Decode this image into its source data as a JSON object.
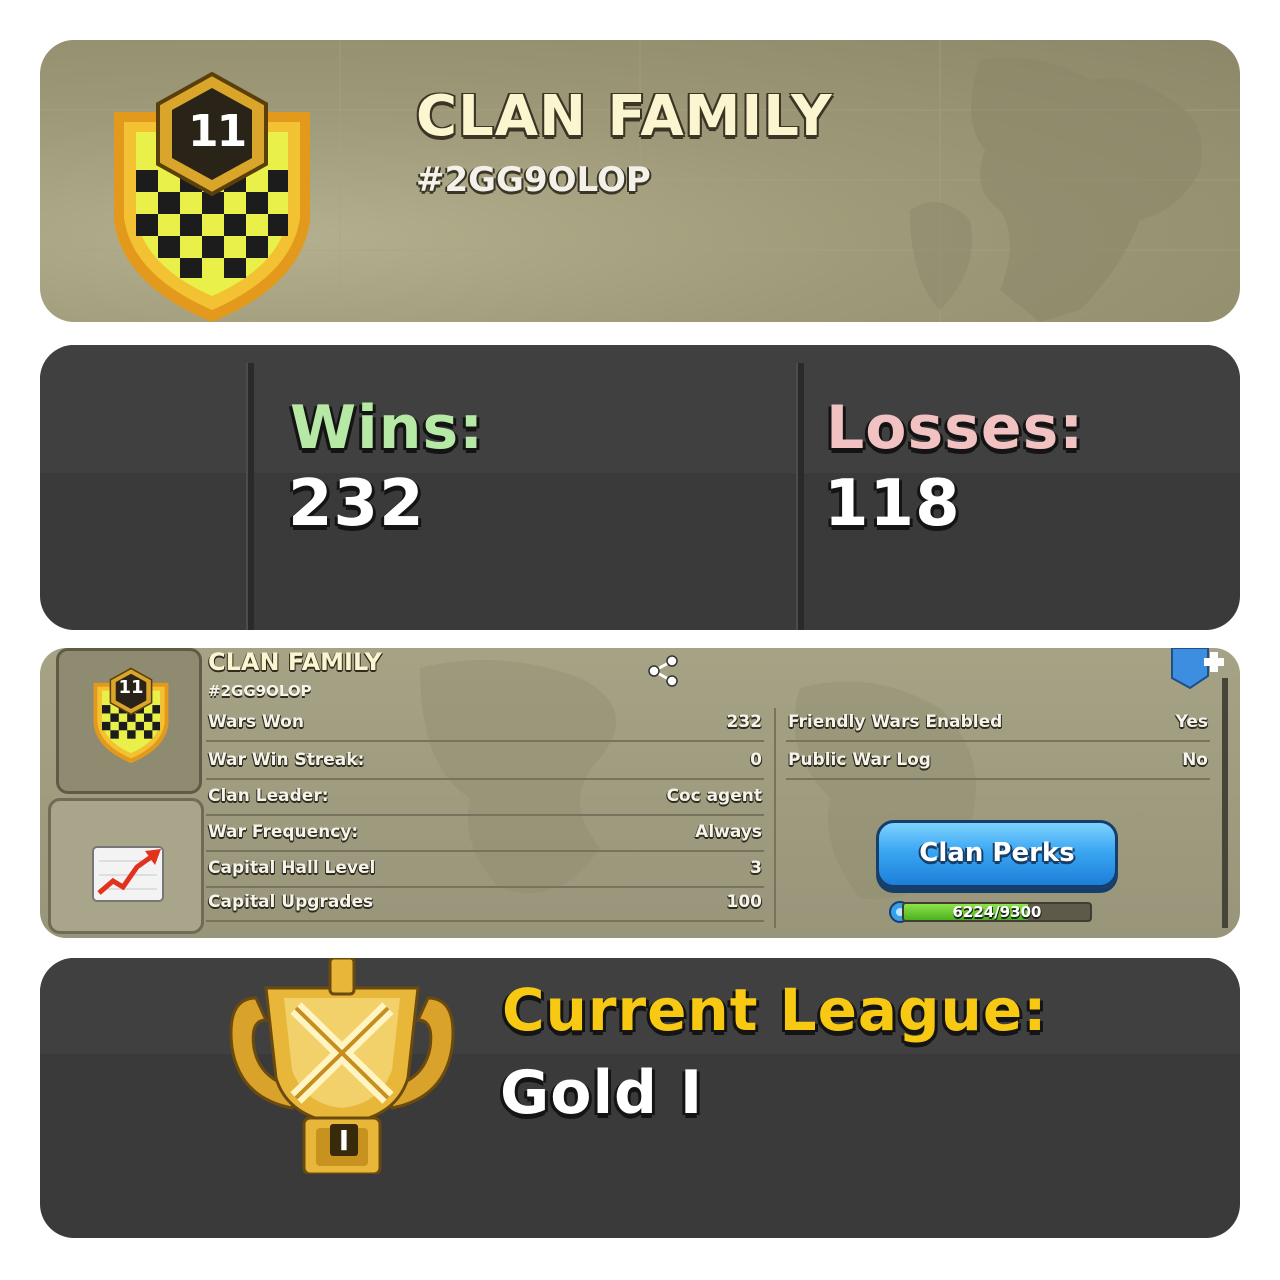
{
  "header": {
    "clan_name": "CLAN FAMILY",
    "clan_tag": "#2GG9OLOP",
    "badge_level": "11"
  },
  "war_stats": {
    "wins_label": "Wins:",
    "wins_value": "232",
    "losses_label": "Losses:",
    "losses_value": "118"
  },
  "clan_info": {
    "clan_name": "CLAN FAMILY",
    "clan_tag": "#2GG9OLOP",
    "badge_level": "11",
    "left_rows": [
      {
        "label": "Wars Won",
        "value": "232"
      },
      {
        "label": "War Win Streak:",
        "value": "0"
      },
      {
        "label": "Clan Leader:",
        "value": "Coc agent"
      },
      {
        "label": "War Frequency:",
        "value": "Always"
      },
      {
        "label": "Capital Hall Level",
        "value": "3"
      },
      {
        "label": "Capital Upgrades",
        "value": "100"
      }
    ],
    "right_rows": [
      {
        "label": "Friendly Wars Enabled",
        "value": "Yes"
      },
      {
        "label": "Public War Log",
        "value": "No"
      }
    ],
    "perks_button": "Clan Perks",
    "xp_text": "6224/9300",
    "xp_fraction": 0.669
  },
  "league": {
    "label": "Current League:",
    "value": "Gold I",
    "rank_digit": "I"
  },
  "colors": {
    "wins": "#b6e8a6",
    "losses": "#f2c2c2",
    "league_label": "#f7c912",
    "title": "#fbf6cf"
  }
}
